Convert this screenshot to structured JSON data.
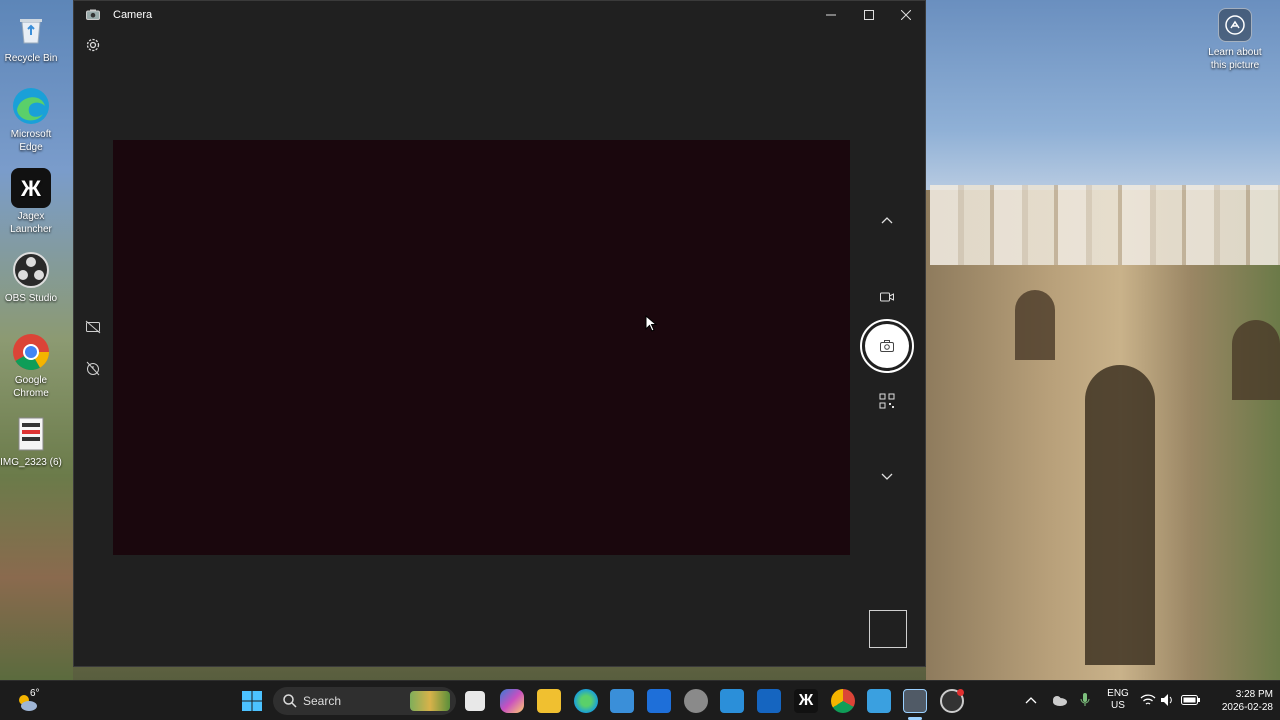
{
  "desktop": {
    "icons": [
      {
        "name": "Recycle Bin"
      },
      {
        "name": "Microsoft Edge"
      },
      {
        "name": "Jagex Launcher"
      },
      {
        "name": "OBS Studio"
      },
      {
        "name": "Google Chrome"
      },
      {
        "name": "IMG_2323 (6)"
      }
    ],
    "learn_about": "Learn about this picture"
  },
  "camera_window": {
    "title": "Camera",
    "controls": {
      "minimize": "minimize",
      "maximize": "maximize",
      "close": "close"
    }
  },
  "taskbar": {
    "weather_temp": "6°",
    "search_placeholder": "Search",
    "language_line1": "ENG",
    "language_line2": "US",
    "time": "3:28 PM",
    "date": "2026-02-28"
  },
  "colors": {
    "window_bg": "#202020",
    "preview_bg": "#1a070d",
    "taskbar_bg": "#1c1c1c",
    "accent": "#0078d4"
  }
}
